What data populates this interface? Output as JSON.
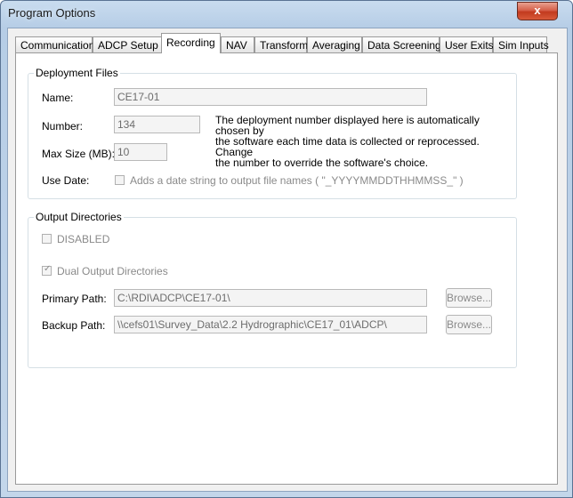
{
  "window": {
    "title": "Program Options",
    "close_glyph": "x"
  },
  "tabs": [
    {
      "label": "Communications",
      "active": false
    },
    {
      "label": "ADCP Setup",
      "active": false
    },
    {
      "label": "Recording",
      "active": true
    },
    {
      "label": "NAV",
      "active": false
    },
    {
      "label": "Transform",
      "active": false
    },
    {
      "label": "Averaging",
      "active": false
    },
    {
      "label": "Data Screening",
      "active": false
    },
    {
      "label": "User Exits",
      "active": false
    },
    {
      "label": "Sim Inputs",
      "active": false
    }
  ],
  "deployment": {
    "group_title": "Deployment Files",
    "name_label": "Name:",
    "name_value": "CE17-01",
    "number_label": "Number:",
    "number_value": "134",
    "note_lines": [
      "The deployment number displayed here is automatically chosen by",
      "the software each time data is collected or reprocessed. Change",
      "the number to override the software's choice."
    ],
    "maxsize_label": "Max Size (MB):",
    "maxsize_value": "10",
    "usedate_label": "Use Date:",
    "usedate_checked": false,
    "usedate_text": "Adds a date string to output file names ( \"_YYYYMMDDTHHMMSS_\" )"
  },
  "output": {
    "group_title": "Output Directories",
    "disabled_checked": false,
    "disabled_label": "DISABLED",
    "dual_checked": true,
    "dual_label": "Dual Output Directories",
    "primary_label": "Primary Path:",
    "primary_value": "C:\\RDI\\ADCP\\CE17-01\\",
    "backup_label": "Backup Path:",
    "backup_value": "\\\\cefs01\\Survey_Data\\2.2 Hydrographic\\CE17_01\\ADCP\\",
    "browse_label": "Browse..."
  }
}
